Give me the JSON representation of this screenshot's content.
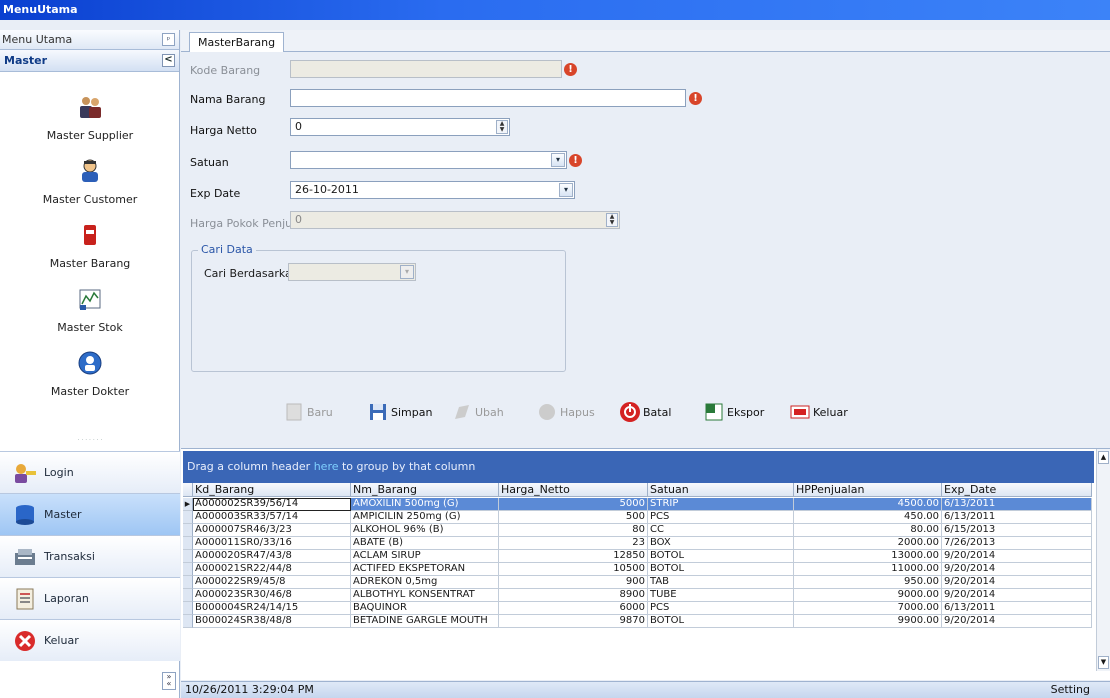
{
  "window": {
    "title": "MenuUtama"
  },
  "nav": {
    "header": "Menu Utama",
    "pin_glyph": "ᵖ",
    "group": "Master",
    "collapse_glyph": "<",
    "items": [
      {
        "label": "Master Supplier",
        "icon": "supplier-icon"
      },
      {
        "label": "Master Customer",
        "icon": "customer-icon"
      },
      {
        "label": "Master Barang",
        "icon": "barang-icon"
      },
      {
        "label": "Master Stok",
        "icon": "stok-icon"
      },
      {
        "label": "Master Dokter",
        "icon": "dokter-icon"
      }
    ],
    "buttons": [
      {
        "label": "Login",
        "icon": "login-icon"
      },
      {
        "label": "Master",
        "icon": "master-icon",
        "active": true
      },
      {
        "label": "Transaksi",
        "icon": "transaksi-icon"
      },
      {
        "label": "Laporan",
        "icon": "laporan-icon"
      },
      {
        "label": "Keluar",
        "icon": "keluar-icon"
      }
    ]
  },
  "tab": {
    "label": "MasterBarang"
  },
  "form": {
    "kode_barang": {
      "label": "Kode Barang",
      "value": ""
    },
    "nama_barang": {
      "label": "Nama Barang",
      "value": ""
    },
    "harga_netto": {
      "label": "Harga Netto",
      "value": "0"
    },
    "satuan": {
      "label": "Satuan",
      "value": ""
    },
    "exp_date": {
      "label": "Exp Date",
      "value": "26-10-2011"
    },
    "harga_pokok": {
      "label": "Harga Pokok Penjualan",
      "value": "0"
    },
    "cari": {
      "legend": "Cari Data",
      "label": "Cari Berdasarkan",
      "value": ""
    }
  },
  "toolbar": {
    "baru": "Baru",
    "simpan": "Simpan",
    "ubah": "Ubah",
    "hapus": "Hapus",
    "batal": "Batal",
    "ekspor": "Ekspor",
    "keluar": "Keluar"
  },
  "grid": {
    "group_hint_pre": "Drag a column header ",
    "group_hint_here": "here",
    "group_hint_post": " to group by that column",
    "columns": [
      "Kd_Barang",
      "Nm_Barang",
      "Harga_Netto",
      "Satuan",
      "HPPenjualan",
      "Exp_Date"
    ],
    "rows": [
      [
        "A000002SR39/56/14",
        "AMOXILIN 500mg (G)",
        "5000",
        "STRIP",
        "4500.00",
        "6/13/2011"
      ],
      [
        "A000003SR33/57/14",
        "AMPICILIN 250mg (G)",
        "500",
        "PCS",
        "450.00",
        "6/13/2011"
      ],
      [
        "A000007SR46/3/23",
        "ALKOHOL 96% (B)",
        "80",
        "CC",
        "80.00",
        "6/15/2013"
      ],
      [
        "A000011SR0/33/16",
        "ABATE (B)",
        "23",
        "BOX",
        "2000.00",
        "7/26/2013"
      ],
      [
        "A000020SR47/43/8",
        "ACLAM SIRUP",
        "12850",
        "BOTOL",
        "13000.00",
        "9/20/2014"
      ],
      [
        "A000021SR22/44/8",
        "ACTIFED EKSPETORAN",
        "10500",
        "BOTOL",
        "11000.00",
        "9/20/2014"
      ],
      [
        "A000022SR9/45/8",
        "ADREKON 0,5mg",
        "900",
        "TAB",
        "950.00",
        "9/20/2014"
      ],
      [
        "A000023SR30/46/8",
        "ALBOTHYL KONSENTRAT",
        "8900",
        "TUBE",
        "9000.00",
        "9/20/2014"
      ],
      [
        "B000004SR24/14/15",
        "BAQUINOR",
        "6000",
        "PCS",
        "7000.00",
        "6/13/2011"
      ],
      [
        "B000024SR38/48/8",
        "BETADINE GARGLE MOUTH",
        "9870",
        "BOTOL",
        "9900.00",
        "9/20/2014"
      ]
    ]
  },
  "status": {
    "datetime": "10/26/2011 3:29:04 PM",
    "setting": "Setting"
  },
  "colors": {
    "title_bar": "#1f5fe8",
    "selected_row": "#5b8ad6",
    "group_bar": "#3a66b6"
  }
}
